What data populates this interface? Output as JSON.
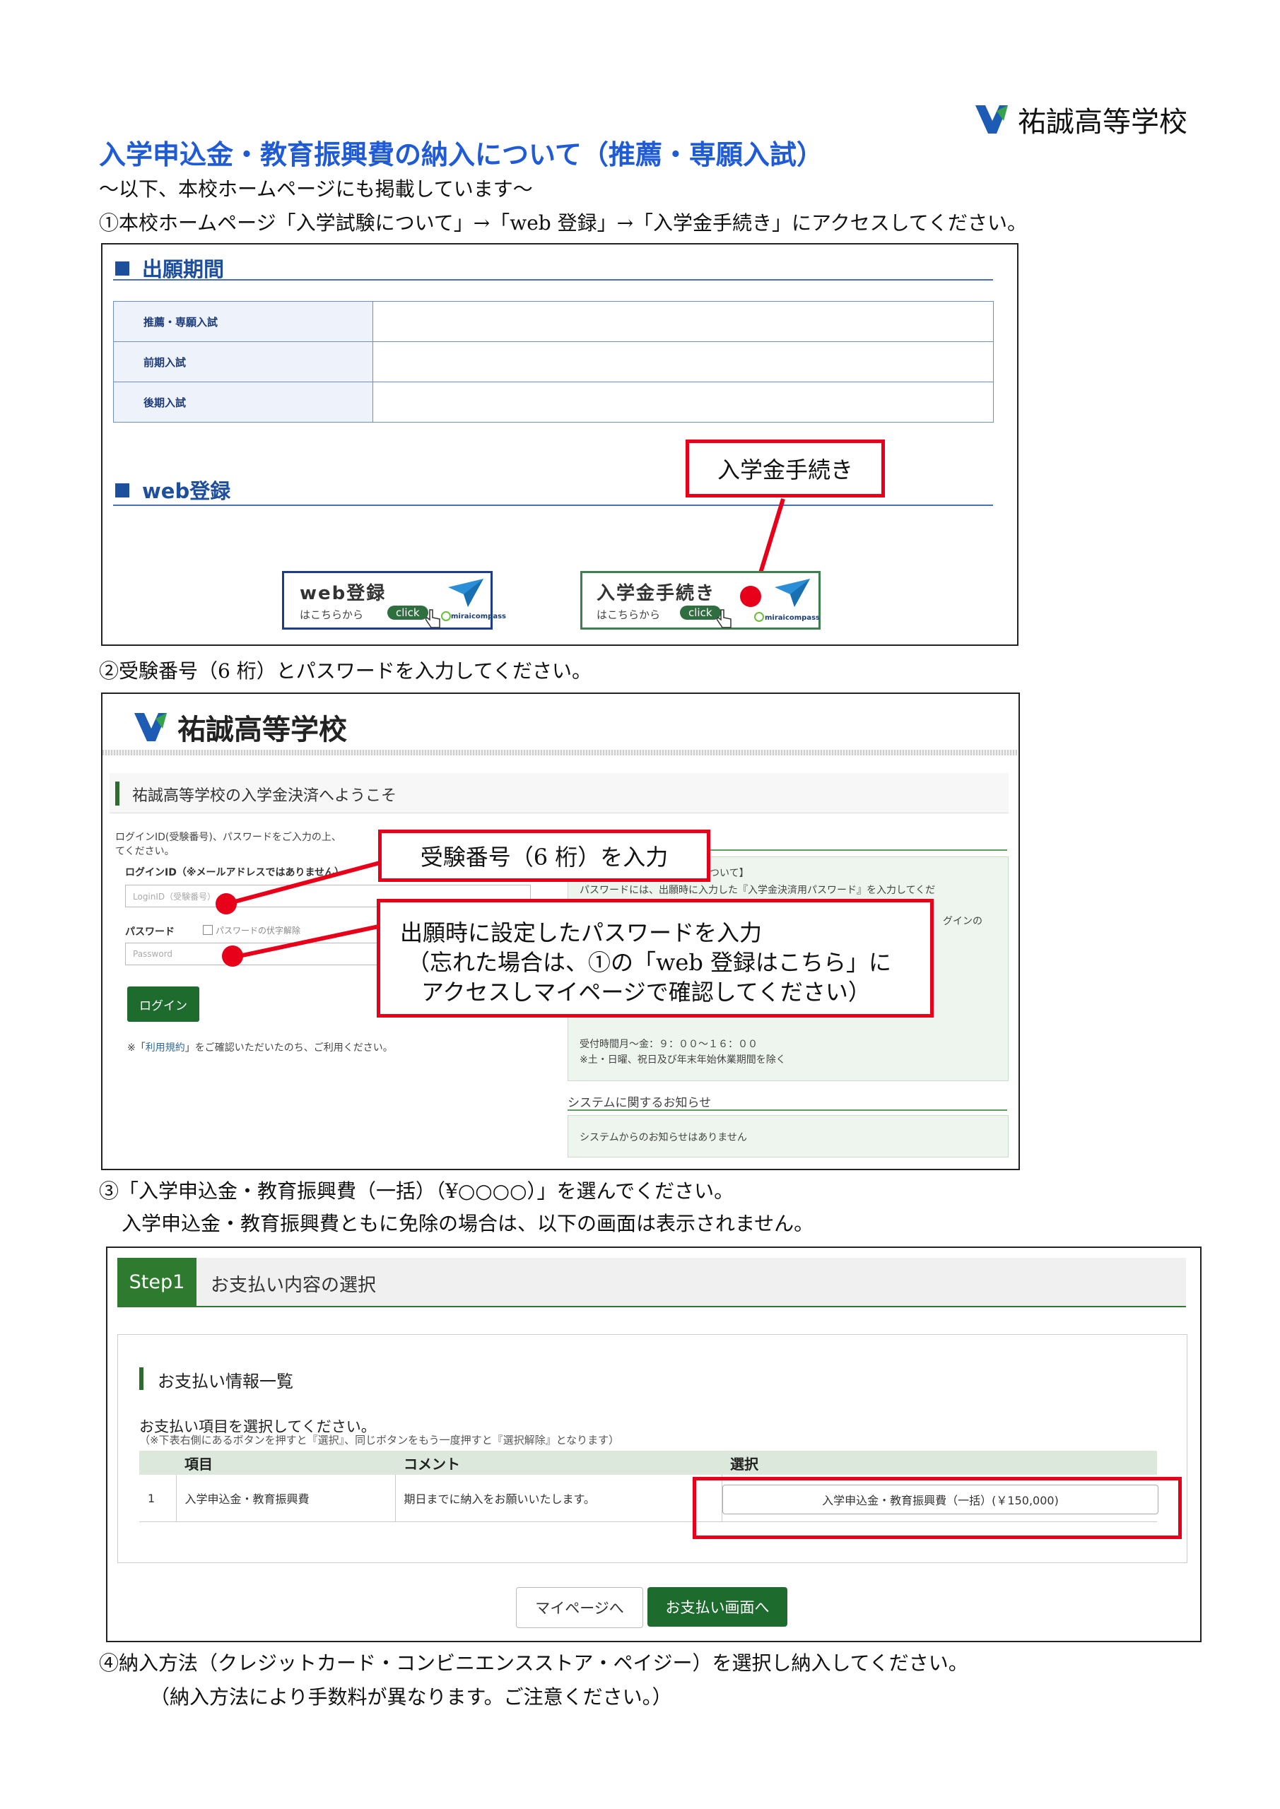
{
  "header": {
    "school_name": "祐誠高等学校"
  },
  "title": "入学申込金・教育振興費の納入について（推薦・専願入試）",
  "subtitle": "～以下、本校ホームページにも掲載しています～",
  "step1_text": "①本校ホームページ「入学試験について」→「web 登録」→「入学金手続き」にアクセスしてください。",
  "panel1": {
    "period_heading": "出願期間",
    "rows": [
      {
        "label": "推薦・専願入試",
        "value": ""
      },
      {
        "label": "前期入試",
        "value": ""
      },
      {
        "label": "後期入試",
        "value": ""
      }
    ],
    "web_heading": "web登録",
    "callout": "入学金手続き",
    "web_button": {
      "title": "web登録",
      "sub": "はこちらから",
      "click": "click",
      "brand": "miraicompass"
    },
    "fee_button": {
      "title": "入学金手続き",
      "sub": "はこちらから",
      "click": "click",
      "brand": "miraicompass"
    }
  },
  "step2_text": "②受験番号（6 桁）とパスワードを入力してください。",
  "panel2": {
    "school_name": "祐誠高等学校",
    "welcome": "祐誠高等学校の入学金決済へようこそ",
    "intro_line1": "ログインID(受験番号)、パスワードをご入力の上、",
    "intro_line2": "てください。",
    "loginid_label": "ログインID（※メールアドレスではありません）",
    "loginid_placeholder": "LoginID（受験番号）",
    "password_label": "パスワード",
    "password_toggle": "パスワードの伏字解除",
    "password_placeholder": "Password",
    "login_button": "ログイン",
    "terms_prefix": "※「",
    "terms_link": "利用規約",
    "terms_suffix": "」をご確認いただいたのち、ご利用ください。",
    "callout_id": "受験番号（6 桁）を入力",
    "callout_pw_line1": "出願時に設定したパスワードを入力",
    "callout_pw_line2": "（忘れた場合は、①の「web 登録はこちら」に",
    "callout_pw_line3": "アクセスしマイページで確認してください）",
    "info_fragment1": "ついて】",
    "info_fragment2": "パスワードには、出願時に入力した『入学金決済用パスワード』を入力してくだ",
    "info_fragment3": "グインの",
    "hours_line1": "受付時間月～金：９：００～１６：００",
    "hours_line2": "※土・日曜、祝日及び年末年始休業期間を除く",
    "system_heading": "システムに関するお知らせ",
    "system_notice": "システムからのお知らせはありません"
  },
  "step3_text": "③「入学申込金・教育振興費（一括）（¥○○○○）」を選んでください。",
  "step3_note": "入学申込金・教育振興費ともに免除の場合は、以下の画面は表示されません。",
  "panel3": {
    "step_badge": "Step1",
    "step_title": "お支払い内容の選択",
    "list_heading": "お支払い情報一覧",
    "instruction": "お支払い項目を選択してください。",
    "instruction_note": "（※下表右側にあるボタンを押すと『選択』、同じボタンをもう一度押すと『選択解除』となります）",
    "columns": [
      "項目",
      "コメント",
      "選択"
    ],
    "row": {
      "no": "1",
      "item": "入学申込金・教育振興費",
      "comment": "期日までに納入をお願いいたします。",
      "select": "入学申込金・教育振興費（一括）(￥150,000)"
    },
    "mypage_button": "マイページへ",
    "pay_button": "お支払い画面へ"
  },
  "step4_text": "④納入方法（クレジットカード・コンビニエンスストア・ペイジー）を選択し納入してください。",
  "step4_note": "（納入方法により手数料が異なります。ご注意ください。）",
  "colors": {
    "title_blue": "#1f5bd6",
    "accent_red": "#e8001a",
    "brand_green": "#1e6b2e"
  }
}
